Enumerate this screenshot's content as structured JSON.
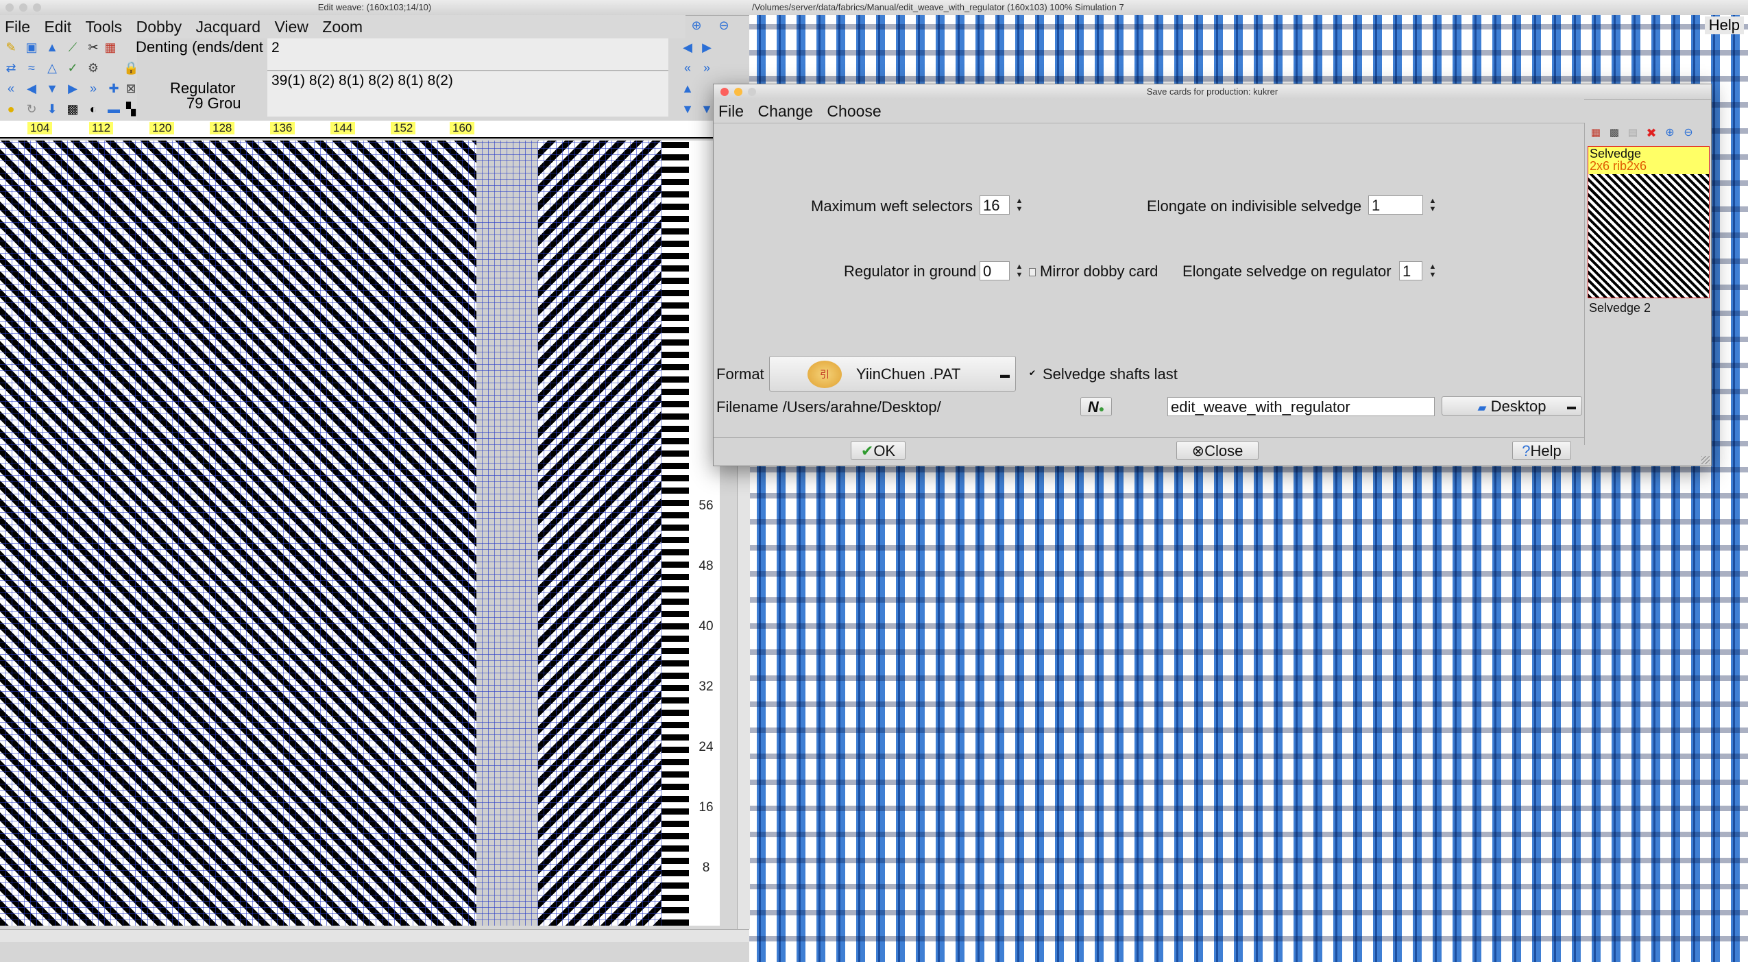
{
  "left_window": {
    "title": "Edit weave:  (160x103;14/10)",
    "menu": [
      "File",
      "Edit",
      "Tools",
      "Dobby",
      "Jacquard",
      "View",
      "Zoom"
    ],
    "denting_label": "Denting (ends/dent",
    "denting_value": "2",
    "regulator_label": "Regulator",
    "groups_label": "79 Grou",
    "regulator_value": "39(1) 8(2) 8(1) 8(2) 8(1) 8(2)",
    "ruler": [
      "104",
      "112",
      "120",
      "128",
      "136",
      "144",
      "152",
      "160"
    ],
    "row_numbers": [
      "56",
      "48",
      "40",
      "32",
      "24",
      "16",
      "8"
    ]
  },
  "right_window": {
    "title": "/Volumes/server/data/fabrics/Manual/edit_weave_with_regulator (160x103) 100% Simulation 7",
    "help": "Help"
  },
  "dialog": {
    "title": "Save cards for production: kukrer",
    "menu": [
      "File",
      "Change",
      "Choose"
    ],
    "max_weft_label": "Maximum weft selectors",
    "max_weft_value": "16",
    "elongate_indivisible_label": "Elongate on indivisible selvedge",
    "elongate_indivisible_value": "1",
    "regulator_ground_label": "Regulator in ground",
    "regulator_ground_value": "0",
    "mirror_label": "Mirror dobby card",
    "elongate_regulator_label": "Elongate selvedge on regulator",
    "elongate_regulator_value": "1",
    "format_label": "Format",
    "format_value": "YiinChuen .PAT",
    "selvedge_last_label": "Selvedge shafts last",
    "filename_label": "Filename /Users/arahne/Desktop/",
    "filename_value": "edit_weave_with_regulator",
    "location_value": "Desktop",
    "ok": "OK",
    "close": "Close",
    "help": "Help",
    "selvedge_list": [
      {
        "name": "Selvedge",
        "sub": "2x6 rib2x6"
      },
      {
        "name": "Selvedge 2"
      }
    ]
  },
  "colors": {
    "accent": "#3f7fd4",
    "dark_blue": "#1c4fa0",
    "highlight": "#ffff66",
    "selvedge_sub": "#e05a00"
  }
}
